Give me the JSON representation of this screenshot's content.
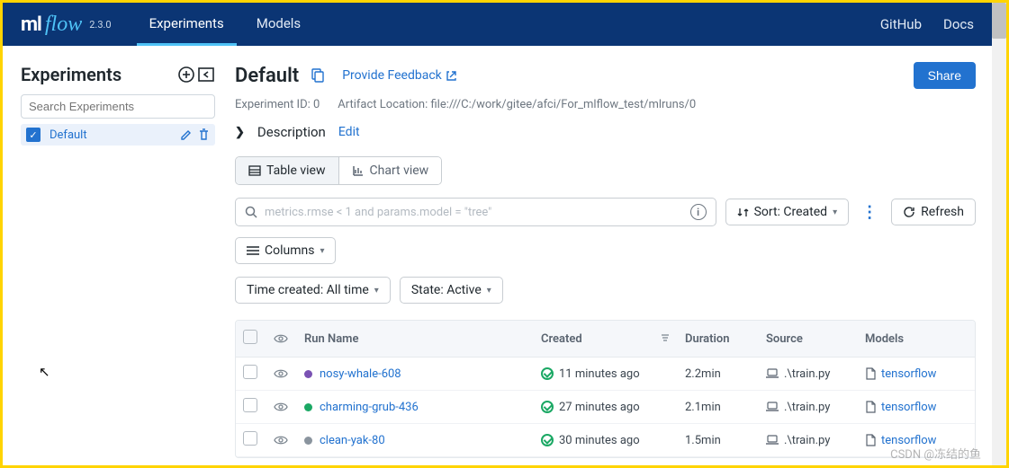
{
  "header": {
    "logo": {
      "ml": "ml",
      "flow": "flow"
    },
    "version": "2.3.0",
    "tabs": [
      {
        "label": "Experiments",
        "active": true
      },
      {
        "label": "Models",
        "active": false
      }
    ],
    "right": {
      "github": "GitHub",
      "docs": "Docs"
    }
  },
  "sidebar": {
    "title": "Experiments",
    "search_placeholder": "Search Experiments",
    "items": [
      {
        "name": "Default",
        "selected": true
      }
    ]
  },
  "main": {
    "title": "Default",
    "feedback": "Provide Feedback",
    "share": "Share",
    "experiment_id_label": "Experiment ID: 0",
    "artifact_label": "Artifact Location: file:///C:/work/gitee/afci/For_mlflow_test/mlruns/0",
    "description_label": "Description",
    "edit_label": "Edit",
    "views": {
      "table": "Table view",
      "chart": "Chart view"
    },
    "search_placeholder": "metrics.rmse < 1 and params.model = \"tree\"",
    "sort_btn": "Sort: Created",
    "refresh": "Refresh",
    "columns_btn": "Columns",
    "filters": {
      "time": "Time created: All time",
      "state": "State: Active"
    },
    "columns": {
      "run_name": "Run Name",
      "created": "Created",
      "duration": "Duration",
      "source": "Source",
      "models": "Models"
    },
    "rows": [
      {
        "dot": "#7a52b3",
        "name": "nosy-whale-608",
        "created": "11 minutes ago",
        "duration": "2.2min",
        "source": ".\\train.py",
        "model": "tensorflow"
      },
      {
        "dot": "#1ba864",
        "name": "charming-grub-436",
        "created": "27 minutes ago",
        "duration": "2.1min",
        "source": ".\\train.py",
        "model": "tensorflow"
      },
      {
        "dot": "#8a949e",
        "name": "clean-yak-80",
        "created": "30 minutes ago",
        "duration": "1.5min",
        "source": ".\\train.py",
        "model": "tensorflow"
      }
    ]
  },
  "watermark": "CSDN @冻结的鱼"
}
